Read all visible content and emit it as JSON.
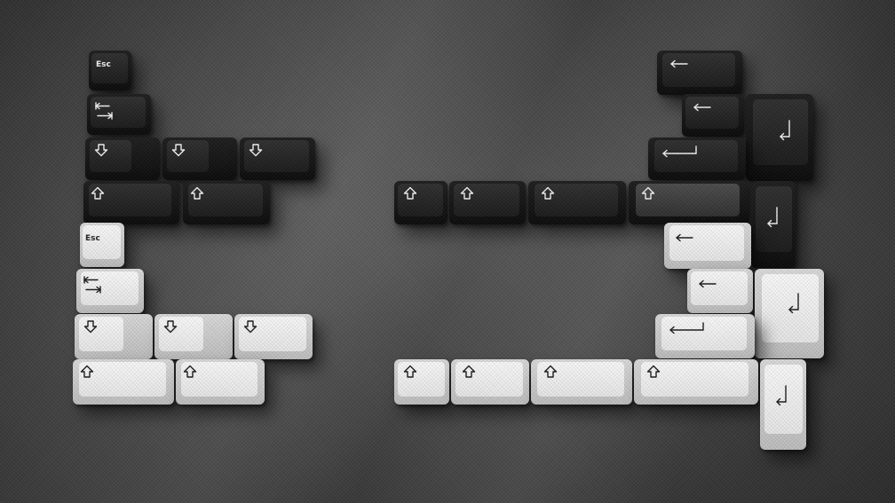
{
  "scene": {
    "subject": "",
    "background": "dark-gray-textured-fabric",
    "colors": {
      "black_keycap": "#121212",
      "white_keycap": "#ececec",
      "legend_dark": "#1a1a1a",
      "legend_light": "#f2f2f2",
      "mat": "#464646"
    }
  },
  "legends": {
    "esc": "Esc"
  },
  "keycaps": {
    "black": [
      "esc",
      "tab",
      "shift",
      "shift",
      "shift",
      "shift",
      "shift",
      "shift",
      "shift",
      "shift",
      "shift",
      "backspace",
      "backspace",
      "backspace",
      "enter",
      "enter"
    ],
    "white": [
      "esc",
      "tab",
      "shift",
      "shift",
      "shift",
      "shift",
      "shift",
      "shift",
      "shift",
      "shift",
      "shift",
      "backspace",
      "backspace",
      "backspace",
      "enter",
      "enter"
    ]
  },
  "icons": [
    "shift-arrow-icon",
    "tab-arrows-icon",
    "backspace-arrow-icon",
    "enter-arrow-icon"
  ]
}
